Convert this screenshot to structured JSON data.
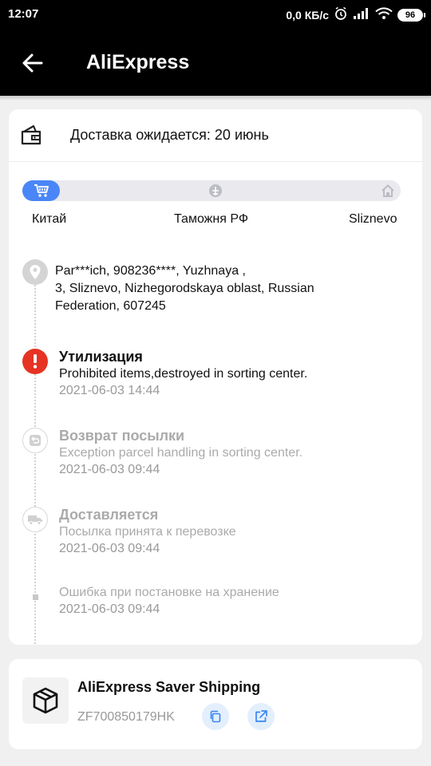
{
  "status_bar": {
    "time": "12:07",
    "network_speed": "0,0 КБ/с",
    "battery": "96",
    "icons": [
      "alarm-icon",
      "signal-icon",
      "wifi-icon",
      "battery-icon"
    ]
  },
  "app_bar": {
    "title": "AliExpress",
    "back_icon": "arrow-left-icon"
  },
  "delivery": {
    "icon": "wallet-delivery-icon",
    "text": "Доставка ожидается: 20 июнь"
  },
  "progress": {
    "fill_fraction": 0.1,
    "accent": "#4a86f7",
    "stages": [
      {
        "label": "Китай",
        "icon": "cart-icon"
      },
      {
        "label": "Таможня РФ",
        "icon": "customs-icon"
      },
      {
        "label": "Sliznevo",
        "icon": "home-icon"
      }
    ]
  },
  "address": {
    "icon": "location-pin-icon",
    "text": "Par***ich,  908236****,  Yuzhnaya ,\n3,  Sliznevo,  Nizhegorodskaya oblast,  Russian\nFederation,  607245"
  },
  "events": [
    {
      "title": "Утилизация",
      "desc": "Prohibited items,destroyed in sorting center.",
      "date": "2021-06-03 14:44",
      "icon": "exclamation-icon",
      "status_color": "#e63323"
    },
    {
      "title": "Возврат посылки",
      "desc": "Exception parcel handling in sorting center.",
      "date": "2021-06-03 09:44",
      "icon": "return-icon"
    },
    {
      "title": "Доставляется",
      "desc": "Посылка принята к перевозке",
      "date": "2021-06-03 09:44",
      "icon": "truck-icon"
    },
    {
      "title": "",
      "desc": "Ошибка при постановке на хранение",
      "date": "2021-06-03 09:44",
      "icon": "dot-icon"
    }
  ],
  "shipping": {
    "icon": "package-box-icon",
    "name": "AliExpress Saver Shipping",
    "tracking_number": "ZF700850179HK",
    "copy_icon": "copy-icon",
    "open_icon": "external-link-icon"
  }
}
